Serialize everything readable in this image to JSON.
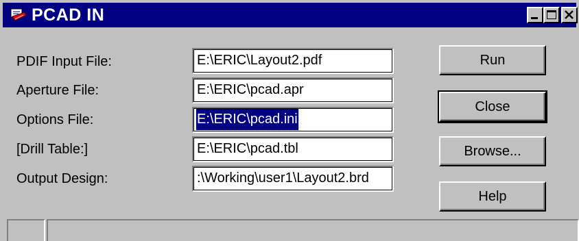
{
  "window": {
    "title": "PCAD IN",
    "icon": "pcad-app-icon",
    "controls": {
      "minimize": "minimize-icon",
      "maximize": "maximize-icon",
      "close": "close-icon"
    }
  },
  "form": {
    "fields": [
      {
        "label": "PDIF Input File:",
        "value": "E:\\ERIC\\Layout2.pdf"
      },
      {
        "label": "Aperture File:",
        "value": "E:\\ERIC\\pcad.apr"
      },
      {
        "label": "Options File:",
        "value": "E:\\ERIC\\pcad.ini",
        "selected": true
      },
      {
        "label": "[Drill Table:]",
        "value": "E:\\ERIC\\pcad.tbl"
      },
      {
        "label": "Output Design:",
        "value": ":\\Working\\user1\\Layout2.brd"
      }
    ]
  },
  "buttons": {
    "run": "Run",
    "close": "Close",
    "browse": "Browse...",
    "help": "Help"
  },
  "statusbar": {
    "panes": [
      "",
      ""
    ]
  },
  "colors": {
    "titlebar": "#000080",
    "face": "#c0c0c0",
    "selection": "#000080"
  }
}
